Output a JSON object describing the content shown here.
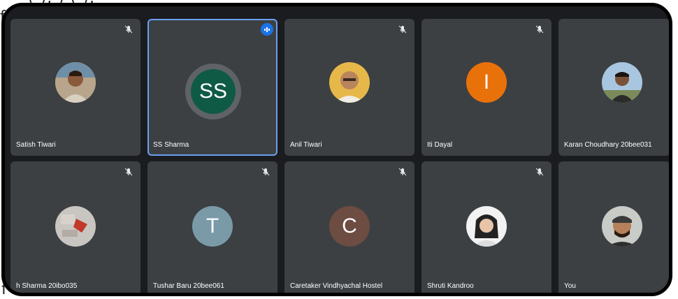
{
  "edge_text": {
    "top": "(       ),                                                   )  (       ),",
    "left_top": "f",
    "left_bottom": "f"
  },
  "colors": {
    "tile_bg": "#3c4043",
    "frame_bg": "#1b1c1f",
    "active_border": "#6a9ff0",
    "speaking_badge": "#1a73e8"
  },
  "participants": [
    {
      "name": "Satish Tiwari",
      "avatar": "photo",
      "muted": true
    },
    {
      "name": "SS Sharma",
      "avatar": "initials",
      "initials": "SS",
      "avatar_color": "#0f5a45",
      "speaking": true
    },
    {
      "name": "Anil Tiwari",
      "avatar": "photo",
      "muted": true
    },
    {
      "name": "Iti Dayal",
      "avatar": "initials",
      "initials": "I",
      "avatar_color": "#e8710a",
      "muted": true
    },
    {
      "name": "Karan Choudhary 20bee031",
      "avatar": "photo",
      "muted": false
    },
    {
      "name": "h Sharma 20ibo035",
      "avatar": "photo",
      "muted": true
    },
    {
      "name": "Tushar Baru 20bee061",
      "avatar": "initials",
      "initials": "T",
      "avatar_color": "#7b9aa8",
      "muted": true
    },
    {
      "name": "Caretaker Vindhyachal Hostel",
      "avatar": "initials",
      "initials": "C",
      "avatar_color": "#6d4c41",
      "muted": true
    },
    {
      "name": "Shruti Kandroo",
      "avatar": "photo",
      "muted": true
    },
    {
      "name": "You",
      "avatar": "photo",
      "muted": false
    }
  ]
}
